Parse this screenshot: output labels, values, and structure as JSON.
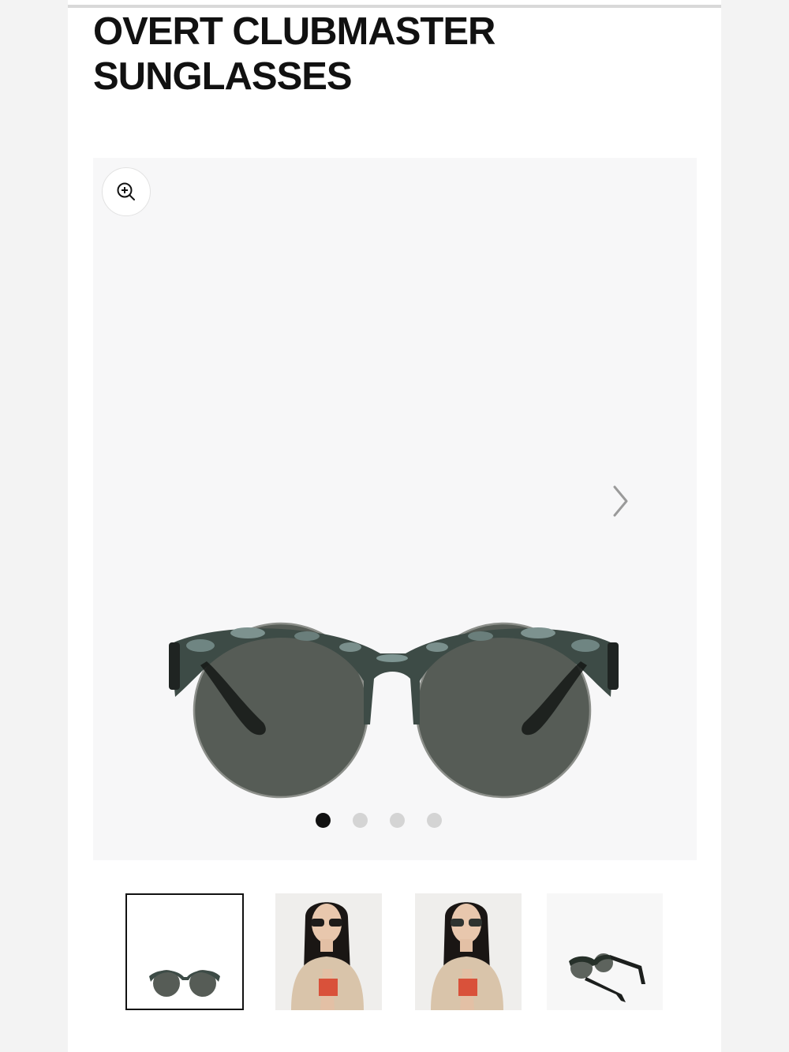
{
  "product": {
    "title": "OVERT CLUBMASTER SUNGLASSES"
  },
  "gallery": {
    "zoom_icon": "zoom-in-icon",
    "next_icon": "chevron-right-icon",
    "slide_count": 4,
    "active_slide": 1
  },
  "thumbnails": [
    {
      "subject": "front-view",
      "selected": true
    },
    {
      "subject": "model-wearing",
      "selected": false
    },
    {
      "subject": "model-wearing",
      "selected": false
    },
    {
      "subject": "side-view",
      "selected": false
    }
  ],
  "colors": {
    "frame": "#3d4b46",
    "lens": "#555b55",
    "background": "#f7f7f8",
    "dot_active": "#111111",
    "dot_inactive": "#d4d4d4"
  }
}
